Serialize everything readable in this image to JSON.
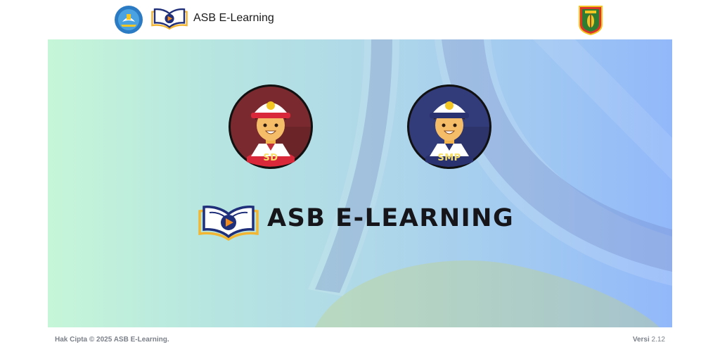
{
  "header": {
    "app_title": "ASB E-Learning",
    "logo_left_name": "kemdikbud-logo",
    "logo_book_name": "asb-book-logo",
    "logo_right_name": "regional-emblem"
  },
  "levels": [
    {
      "label": "SD",
      "color": "#7a2a2e"
    },
    {
      "label": "SMP",
      "color": "#333c7a"
    }
  ],
  "brand": {
    "text": "ASB E-LEARNING"
  },
  "footer": {
    "copyright": "Hak Cipta © 2025 ASB E-Learning.",
    "version_label": "Versi",
    "version_number": "2.12"
  },
  "colors": {
    "book_blue": "#1f2f7a",
    "book_gold": "#f2b632",
    "play_orange": "#f08a1c"
  }
}
